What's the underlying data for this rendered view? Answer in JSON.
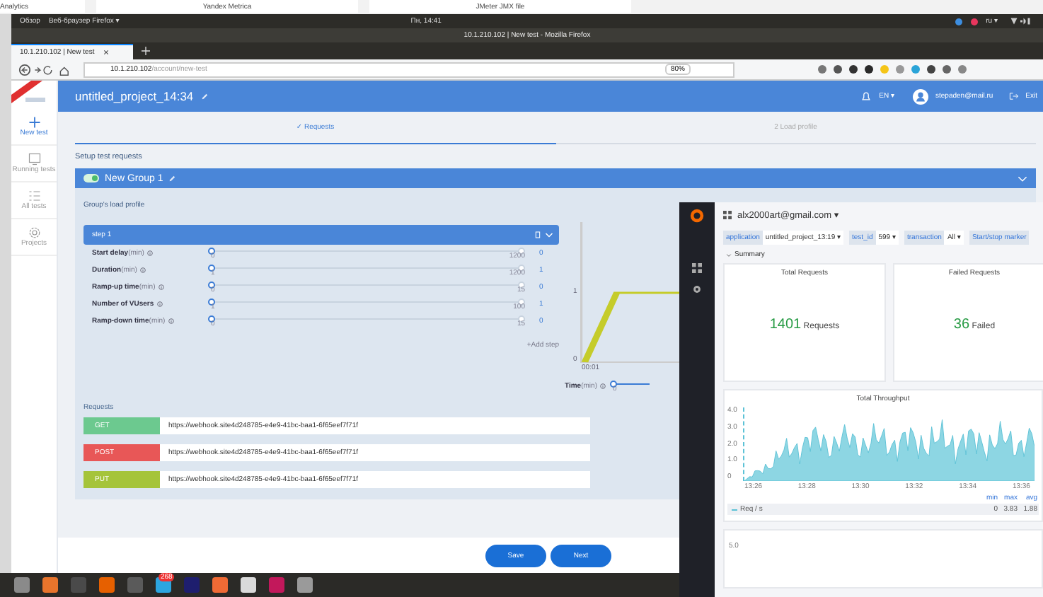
{
  "background_window": {
    "tabs": [
      "Analytics",
      "Yandex Metrica",
      "JMeter JMX file"
    ]
  },
  "top_bar": {
    "activities": "Обзор",
    "app_menu": "Веб-браузер Firefox ▾",
    "clock": "Пн, 14:41",
    "language": "ru ▾"
  },
  "browser": {
    "title": "10.1.210.102 | New test - Mozilla Firefox",
    "tab": "10.1.210.102 | New test",
    "url_host": "10.1.210.102",
    "url_path": "/account/new-test",
    "zoom": "80%"
  },
  "app": {
    "project": "untitled_project_14:34",
    "language": "EN ▾",
    "user": "stepaden@mail.ru",
    "exit": "Exit",
    "sidebar": [
      {
        "label": "New test",
        "kind": "plus",
        "selected": true
      },
      {
        "label": "Running tests",
        "kind": "monitor",
        "selected": false
      },
      {
        "label": "All tests",
        "kind": "list",
        "selected": false
      },
      {
        "label": "Projects",
        "kind": "gear",
        "selected": false
      }
    ],
    "steps": [
      {
        "label": "✓ Requests",
        "selected": true
      },
      {
        "label": "2  Load profile",
        "selected": false
      }
    ],
    "section_title": "Setup test requests",
    "group": {
      "name": "New Group 1",
      "enabled": true,
      "profile_title": "Group's load profile",
      "step_title": "step 1",
      "params": [
        {
          "label": "Start delay",
          "unit": "(min)",
          "min": "0",
          "max": "1200",
          "value": "0",
          "level": 0
        },
        {
          "label": "Duration",
          "unit": "(min)",
          "min": "1",
          "max": "1200",
          "value": "1",
          "level": 0
        },
        {
          "label": "Ramp-up time",
          "unit": "(min)",
          "min": "0",
          "max": "15",
          "value": "0",
          "level": 0
        },
        {
          "label": "Number of VUsers",
          "min": "1",
          "max": "100",
          "value": "1",
          "level": 0
        },
        {
          "label": "Ramp-down time",
          "unit": "(min)",
          "min": "0",
          "max": "15",
          "value": "0",
          "level": 0
        }
      ],
      "add_step": "+Add step",
      "chart": {
        "y_ticks": [
          "1",
          "0"
        ],
        "x_tick": "00:01"
      },
      "time": {
        "label": "Time",
        "unit": "(min)",
        "value": "0",
        "level": 0
      },
      "requests_title": "Requests",
      "requests": [
        {
          "method": "GET",
          "color": "#6cc98f",
          "url": "https://webhook.site4d248785-e4e9-41bc-baa1-6f65eef7f71f"
        },
        {
          "method": "POST",
          "color": "#e85757",
          "url": "https://webhook.site4d248785-e4e9-41bc-baa1-6f65eef7f71f"
        },
        {
          "method": "PUT",
          "color": "#a5c43a",
          "url": "https://webhook.site4d248785-e4e9-41bc-baa1-6f65eef7f71f"
        }
      ]
    },
    "buttons": [
      "Save",
      "Next"
    ]
  },
  "grafana": {
    "user": "alx2000art@gmail.com ▾",
    "filters": [
      {
        "label": "application",
        "value": "untitled_project_13:19 ▾"
      },
      {
        "label": "test_id",
        "value": "599 ▾"
      },
      {
        "label": "transaction",
        "value": "All ▾"
      },
      {
        "label": "Start/stop marker"
      }
    ],
    "row_title": "Summary",
    "stats": [
      {
        "title": "Total Requests",
        "value": "1401",
        "unit": "Requests"
      },
      {
        "title": "Failed Requests",
        "value": "36",
        "unit": "Failed"
      }
    ],
    "throughput": {
      "title": "Total Throughput",
      "y_ticks": [
        "4.0",
        "3.0",
        "2.0",
        "1.0",
        "0"
      ],
      "x_ticks": [
        "13:26",
        "13:28",
        "13:30",
        "13:32",
        "13:34",
        "13:36"
      ],
      "legend_headers": [
        "min",
        "max",
        "avg"
      ],
      "series": "Req / s",
      "legend_values": [
        "0",
        "3.83",
        "1.88"
      ]
    },
    "next_panel": {
      "y_tick": "5.0"
    }
  },
  "taskbar": {
    "apps": [
      {
        "color": "#8a8a8a"
      },
      {
        "color": "#e8742c"
      },
      {
        "color": "#4a4a4a"
      },
      {
        "color": "#e66000"
      },
      {
        "color": "#5a5a5a"
      },
      {
        "color": "#2ca5e0"
      },
      {
        "color": "#1e1e6e"
      },
      {
        "color": "#f06a35"
      },
      {
        "color": "#dadada"
      },
      {
        "color": "#c2185b"
      },
      {
        "color": "#9a9a9a"
      }
    ],
    "badge": "268"
  }
}
